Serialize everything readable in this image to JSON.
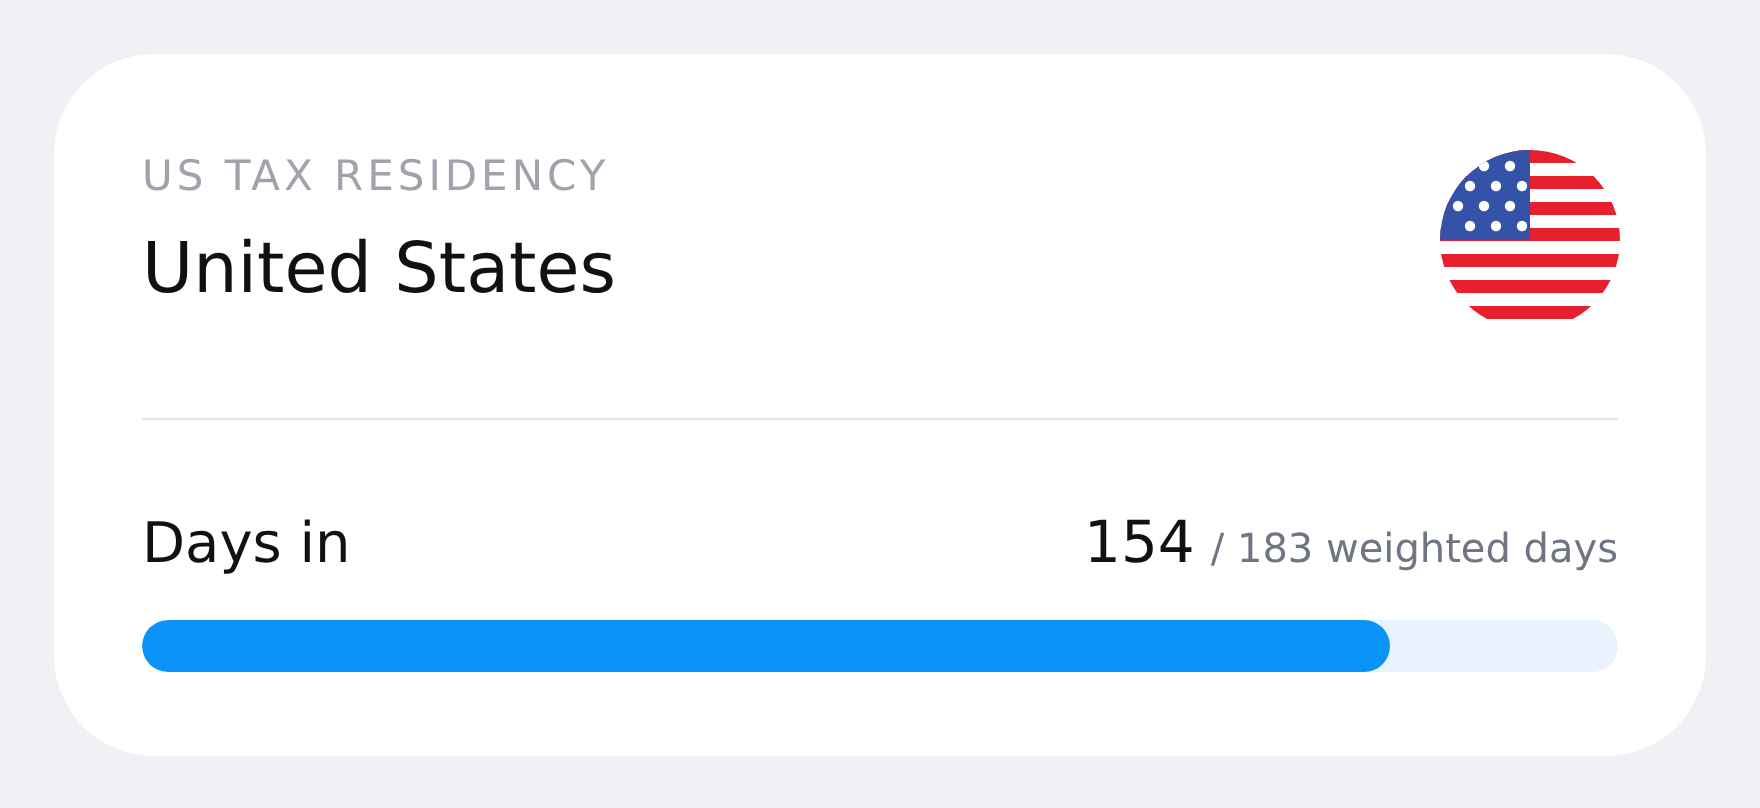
{
  "card": {
    "eyebrow": "US TAX RESIDENCY",
    "title": "United States",
    "metric": {
      "label": "Days in",
      "count": "154",
      "suffix": "/ 183 weighted days"
    },
    "progress": {
      "level": 0.845
    }
  }
}
